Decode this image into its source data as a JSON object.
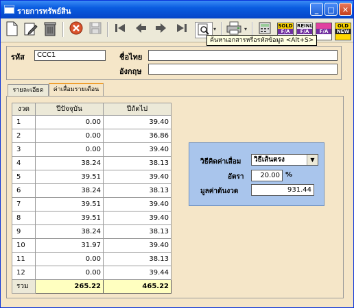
{
  "window": {
    "title": "รายการทรัพย์สิน"
  },
  "titlebar_buttons": {
    "minimize": "_",
    "maximize": "□",
    "close": "✕"
  },
  "toolbar": {
    "tooltip": "ค้นหาเอกสารหรือรหัสข้อมูล  <Alt+S>",
    "icons": [
      "new-document-icon",
      "edit-icon",
      "delete-icon",
      "cancel-icon",
      "save-icon",
      "first-record-icon",
      "previous-record-icon",
      "next-record-icon",
      "last-record-icon",
      "search-icon",
      "print-icon",
      "calculator-icon",
      "sold-fa-icon",
      "resell-fa-icon",
      "reset-fa-icon",
      "old-new-icon"
    ],
    "sold_label": "SOLD",
    "fa_label": "F/A",
    "reinl_label": "REINL",
    "old_label": "OLD",
    "new_label": "NEW"
  },
  "header": {
    "code_label": "รหัส",
    "code_value": "CCC1",
    "thai_name_label": "ชื่อไทย",
    "thai_name_value": "",
    "english_name_label": "อังกฤษ",
    "english_name_value": ""
  },
  "tabs": [
    {
      "label": "รายละเอียด",
      "active": false
    },
    {
      "label": "ค่าเสื่อมรายเดือน",
      "active": true
    }
  ],
  "grid": {
    "columns": [
      "งวด",
      "ปีปัจจุบัน",
      "ปีถัดไป"
    ],
    "rows": [
      {
        "period": "1",
        "current": "0.00",
        "next": "39.40"
      },
      {
        "period": "2",
        "current": "0.00",
        "next": "36.86"
      },
      {
        "period": "3",
        "current": "0.00",
        "next": "39.40"
      },
      {
        "period": "4",
        "current": "38.24",
        "next": "38.13"
      },
      {
        "period": "5",
        "current": "39.51",
        "next": "39.40"
      },
      {
        "period": "6",
        "current": "38.24",
        "next": "38.13"
      },
      {
        "period": "7",
        "current": "39.51",
        "next": "39.40"
      },
      {
        "period": "8",
        "current": "39.51",
        "next": "39.40"
      },
      {
        "period": "9",
        "current": "38.24",
        "next": "38.13"
      },
      {
        "period": "10",
        "current": "31.97",
        "next": "39.40"
      },
      {
        "period": "11",
        "current": "0.00",
        "next": "38.13"
      },
      {
        "period": "12",
        "current": "0.00",
        "next": "39.44"
      }
    ],
    "total_label": "รวม",
    "total_current": "265.22",
    "total_next": "465.22"
  },
  "depreciation": {
    "method_label": "วิธีคิดค่าเสื่อม",
    "method_value": "วิธีเส้นตรง",
    "rate_label": "อัตรา",
    "rate_value": "20.00",
    "rate_unit": "%",
    "start_value_label": "มูลค่าต้นงวด",
    "start_value": "931.44"
  }
}
